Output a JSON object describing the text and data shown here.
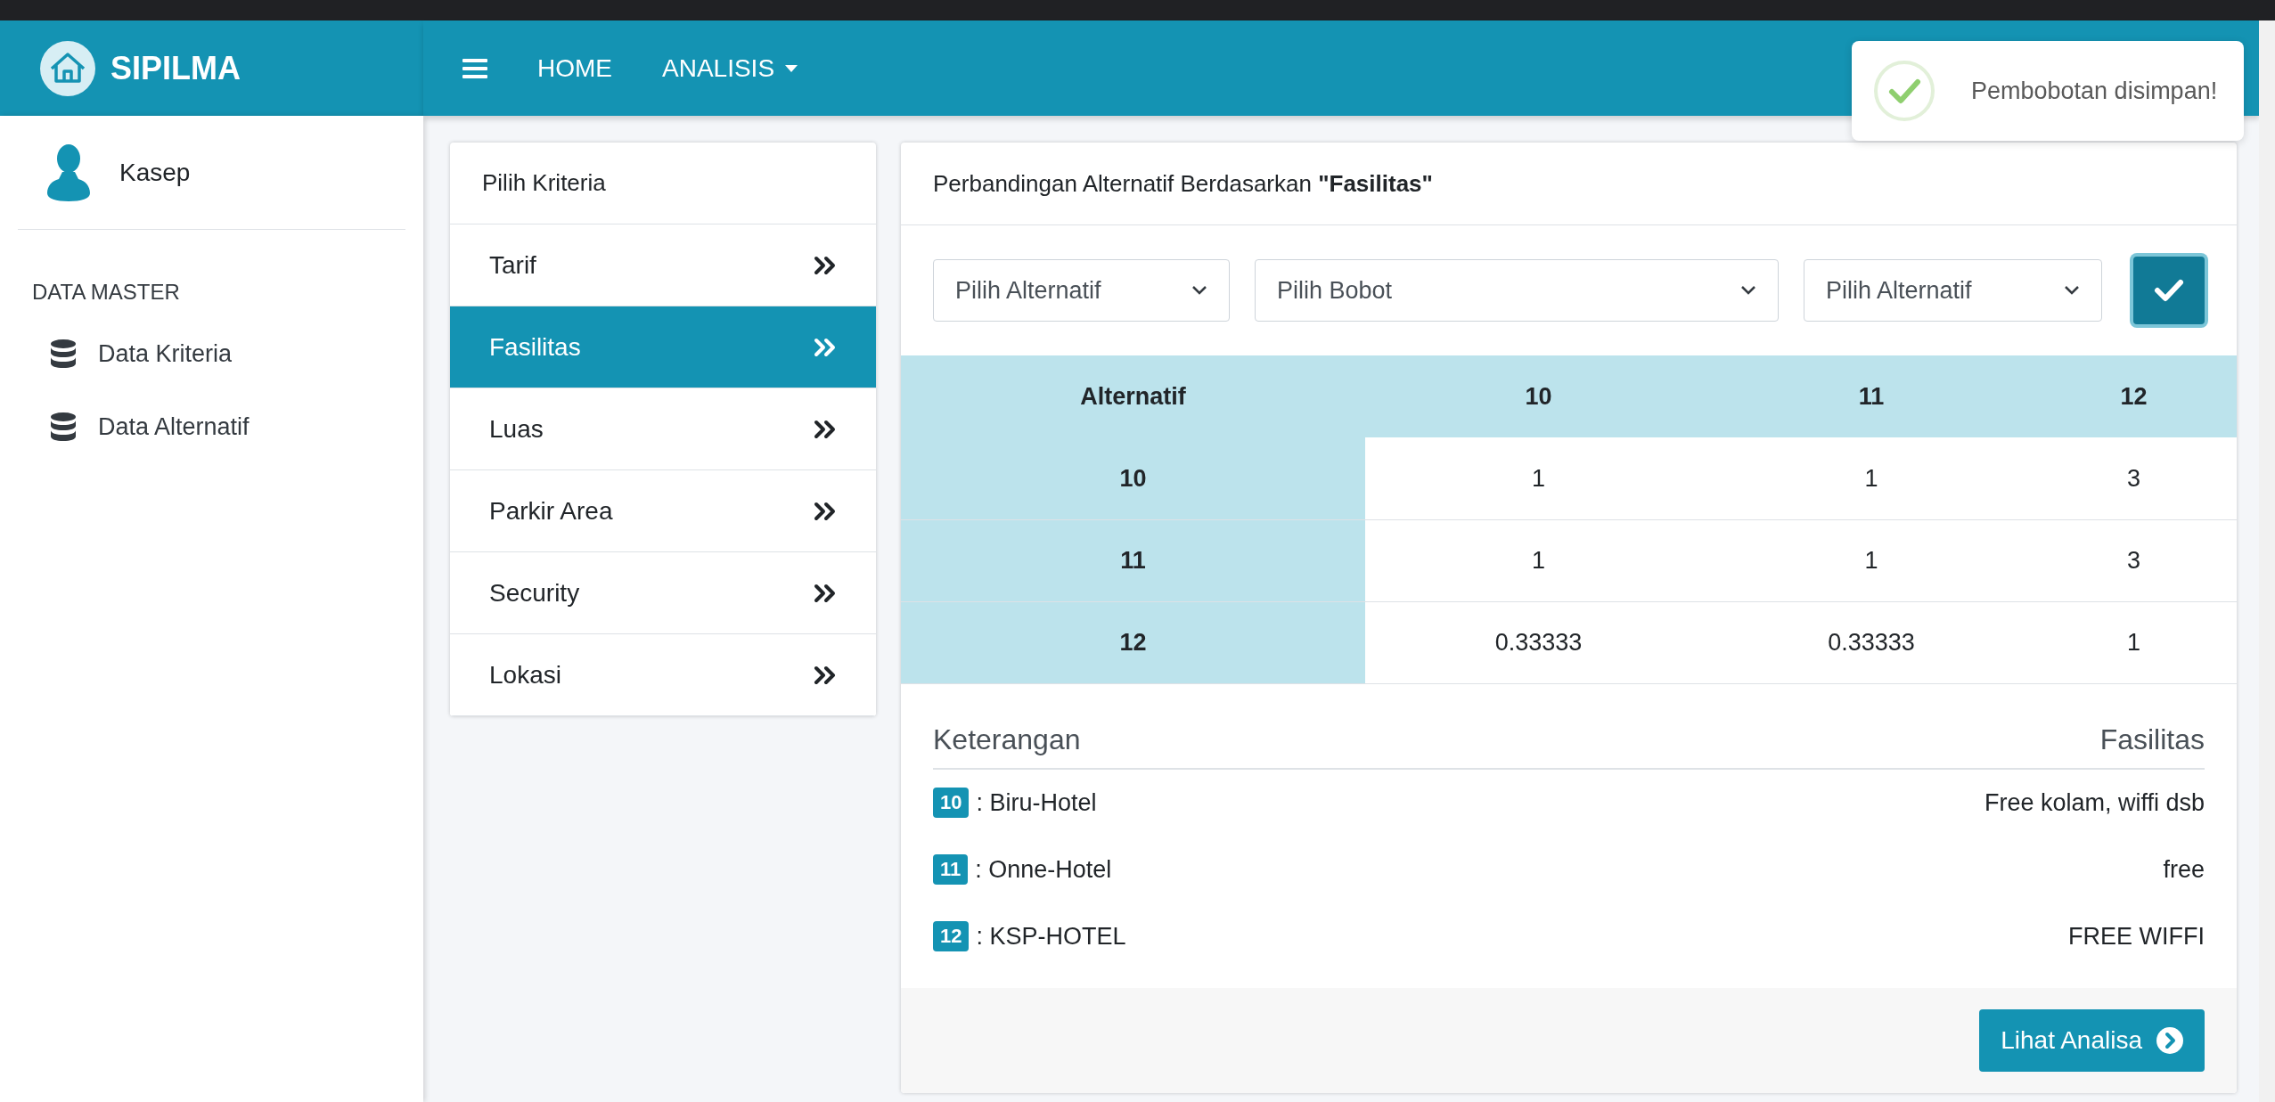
{
  "brand": {
    "title": "SIPILMA"
  },
  "navbar": {
    "items": [
      {
        "label": "HOME",
        "kind": "link"
      },
      {
        "label": "ANALISIS",
        "kind": "dropdown"
      }
    ]
  },
  "user": {
    "name": "Kasep"
  },
  "sidebar": {
    "section": "DATA MASTER",
    "items": [
      {
        "label": "Data Kriteria"
      },
      {
        "label": "Data Alternatif"
      }
    ]
  },
  "criteria_panel": {
    "title": "Pilih Kriteria",
    "items": [
      {
        "label": "Tarif",
        "selected": false
      },
      {
        "label": "Fasilitas",
        "selected": true
      },
      {
        "label": "Luas",
        "selected": false
      },
      {
        "label": "Parkir Area",
        "selected": false
      },
      {
        "label": "Security",
        "selected": false
      },
      {
        "label": "Lokasi",
        "selected": false
      }
    ]
  },
  "comparison": {
    "title": "Perbandingan Alternatif Berdasarkan **\"Fasilitas\"**",
    "selects": [
      {
        "value": "Pilih Alternatif",
        "kind": "alternative"
      },
      {
        "value": "Pilih Bobot",
        "kind": "weight"
      },
      {
        "value": "Pilih Alternatif",
        "kind": "alternative"
      }
    ],
    "table": {
      "columns": [
        "Alternatif",
        "10",
        "11",
        "12"
      ],
      "rows": [
        [
          "10",
          "1",
          "1",
          "3"
        ],
        [
          "11",
          "1",
          "1",
          "3"
        ],
        [
          "12",
          "0.33333",
          "0.33333",
          "1"
        ]
      ]
    },
    "legend": {
      "heading": "Keterangan",
      "value_heading": "Fasilitas",
      "items": [
        {
          "code": "10",
          "name": ": Biru-Hotel",
          "value": "Free kolam, wiffi dsb"
        },
        {
          "code": "11",
          "name": ": Onne-Hotel",
          "value": "free"
        },
        {
          "code": "12",
          "name": ": KSP-HOTEL",
          "value": "FREE WIFFI"
        }
      ]
    },
    "button": "Lihat Analisa"
  },
  "toast": {
    "message": "Pembobotan disimpan!"
  }
}
